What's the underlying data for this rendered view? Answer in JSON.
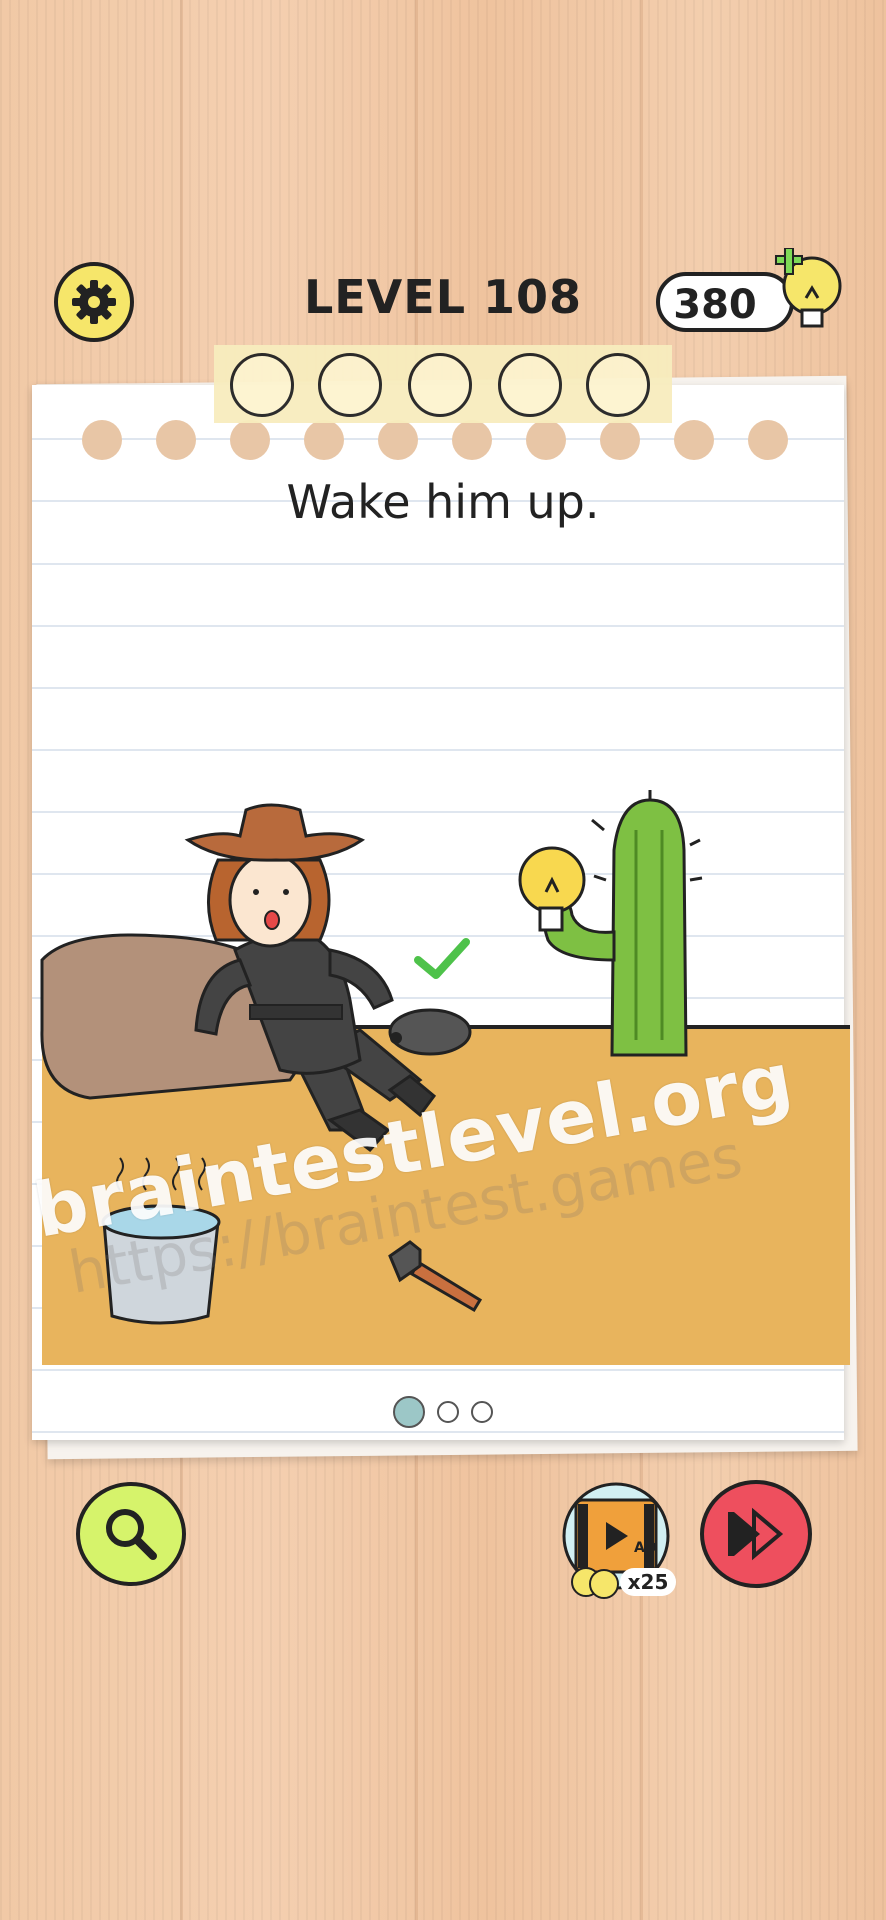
{
  "header": {
    "level_label": "LEVEL 108",
    "hint_count": "380"
  },
  "puzzle": {
    "prompt": "Wake him up.",
    "stars_total": 5,
    "page_indicator": {
      "current": 1,
      "total": 3
    }
  },
  "watermark": {
    "primary": "braintestlevel.org",
    "secondary": "https://braintest.games"
  },
  "bottom_bar": {
    "ad_label": "AD",
    "ad_reward": "x25"
  },
  "colors": {
    "accent_yellow": "#f6e66a",
    "search_green": "#d6f36b",
    "skip_red": "#ee4f5e",
    "sand": "#e8b45d",
    "cactus": "#7ec043",
    "hat": "#b86a3c"
  },
  "icons": [
    "gear-icon",
    "lightbulb-icon",
    "search-icon",
    "skip-icon",
    "video-ad-icon",
    "checkmark-icon"
  ]
}
